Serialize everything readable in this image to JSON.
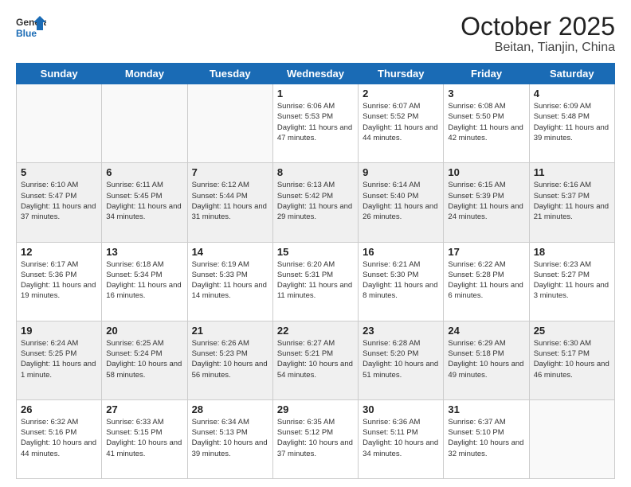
{
  "header": {
    "logo_general": "General",
    "logo_blue": "Blue",
    "month_title": "October 2025",
    "location": "Beitan, Tianjin, China"
  },
  "weekdays": [
    "Sunday",
    "Monday",
    "Tuesday",
    "Wednesday",
    "Thursday",
    "Friday",
    "Saturday"
  ],
  "weeks": [
    [
      {
        "day": "",
        "info": ""
      },
      {
        "day": "",
        "info": ""
      },
      {
        "day": "",
        "info": ""
      },
      {
        "day": "1",
        "info": "Sunrise: 6:06 AM\nSunset: 5:53 PM\nDaylight: 11 hours and 47 minutes."
      },
      {
        "day": "2",
        "info": "Sunrise: 6:07 AM\nSunset: 5:52 PM\nDaylight: 11 hours and 44 minutes."
      },
      {
        "day": "3",
        "info": "Sunrise: 6:08 AM\nSunset: 5:50 PM\nDaylight: 11 hours and 42 minutes."
      },
      {
        "day": "4",
        "info": "Sunrise: 6:09 AM\nSunset: 5:48 PM\nDaylight: 11 hours and 39 minutes."
      }
    ],
    [
      {
        "day": "5",
        "info": "Sunrise: 6:10 AM\nSunset: 5:47 PM\nDaylight: 11 hours and 37 minutes."
      },
      {
        "day": "6",
        "info": "Sunrise: 6:11 AM\nSunset: 5:45 PM\nDaylight: 11 hours and 34 minutes."
      },
      {
        "day": "7",
        "info": "Sunrise: 6:12 AM\nSunset: 5:44 PM\nDaylight: 11 hours and 31 minutes."
      },
      {
        "day": "8",
        "info": "Sunrise: 6:13 AM\nSunset: 5:42 PM\nDaylight: 11 hours and 29 minutes."
      },
      {
        "day": "9",
        "info": "Sunrise: 6:14 AM\nSunset: 5:40 PM\nDaylight: 11 hours and 26 minutes."
      },
      {
        "day": "10",
        "info": "Sunrise: 6:15 AM\nSunset: 5:39 PM\nDaylight: 11 hours and 24 minutes."
      },
      {
        "day": "11",
        "info": "Sunrise: 6:16 AM\nSunset: 5:37 PM\nDaylight: 11 hours and 21 minutes."
      }
    ],
    [
      {
        "day": "12",
        "info": "Sunrise: 6:17 AM\nSunset: 5:36 PM\nDaylight: 11 hours and 19 minutes."
      },
      {
        "day": "13",
        "info": "Sunrise: 6:18 AM\nSunset: 5:34 PM\nDaylight: 11 hours and 16 minutes."
      },
      {
        "day": "14",
        "info": "Sunrise: 6:19 AM\nSunset: 5:33 PM\nDaylight: 11 hours and 14 minutes."
      },
      {
        "day": "15",
        "info": "Sunrise: 6:20 AM\nSunset: 5:31 PM\nDaylight: 11 hours and 11 minutes."
      },
      {
        "day": "16",
        "info": "Sunrise: 6:21 AM\nSunset: 5:30 PM\nDaylight: 11 hours and 8 minutes."
      },
      {
        "day": "17",
        "info": "Sunrise: 6:22 AM\nSunset: 5:28 PM\nDaylight: 11 hours and 6 minutes."
      },
      {
        "day": "18",
        "info": "Sunrise: 6:23 AM\nSunset: 5:27 PM\nDaylight: 11 hours and 3 minutes."
      }
    ],
    [
      {
        "day": "19",
        "info": "Sunrise: 6:24 AM\nSunset: 5:25 PM\nDaylight: 11 hours and 1 minute."
      },
      {
        "day": "20",
        "info": "Sunrise: 6:25 AM\nSunset: 5:24 PM\nDaylight: 10 hours and 58 minutes."
      },
      {
        "day": "21",
        "info": "Sunrise: 6:26 AM\nSunset: 5:23 PM\nDaylight: 10 hours and 56 minutes."
      },
      {
        "day": "22",
        "info": "Sunrise: 6:27 AM\nSunset: 5:21 PM\nDaylight: 10 hours and 54 minutes."
      },
      {
        "day": "23",
        "info": "Sunrise: 6:28 AM\nSunset: 5:20 PM\nDaylight: 10 hours and 51 minutes."
      },
      {
        "day": "24",
        "info": "Sunrise: 6:29 AM\nSunset: 5:18 PM\nDaylight: 10 hours and 49 minutes."
      },
      {
        "day": "25",
        "info": "Sunrise: 6:30 AM\nSunset: 5:17 PM\nDaylight: 10 hours and 46 minutes."
      }
    ],
    [
      {
        "day": "26",
        "info": "Sunrise: 6:32 AM\nSunset: 5:16 PM\nDaylight: 10 hours and 44 minutes."
      },
      {
        "day": "27",
        "info": "Sunrise: 6:33 AM\nSunset: 5:15 PM\nDaylight: 10 hours and 41 minutes."
      },
      {
        "day": "28",
        "info": "Sunrise: 6:34 AM\nSunset: 5:13 PM\nDaylight: 10 hours and 39 minutes."
      },
      {
        "day": "29",
        "info": "Sunrise: 6:35 AM\nSunset: 5:12 PM\nDaylight: 10 hours and 37 minutes."
      },
      {
        "day": "30",
        "info": "Sunrise: 6:36 AM\nSunset: 5:11 PM\nDaylight: 10 hours and 34 minutes."
      },
      {
        "day": "31",
        "info": "Sunrise: 6:37 AM\nSunset: 5:10 PM\nDaylight: 10 hours and 32 minutes."
      },
      {
        "day": "",
        "info": ""
      }
    ]
  ]
}
